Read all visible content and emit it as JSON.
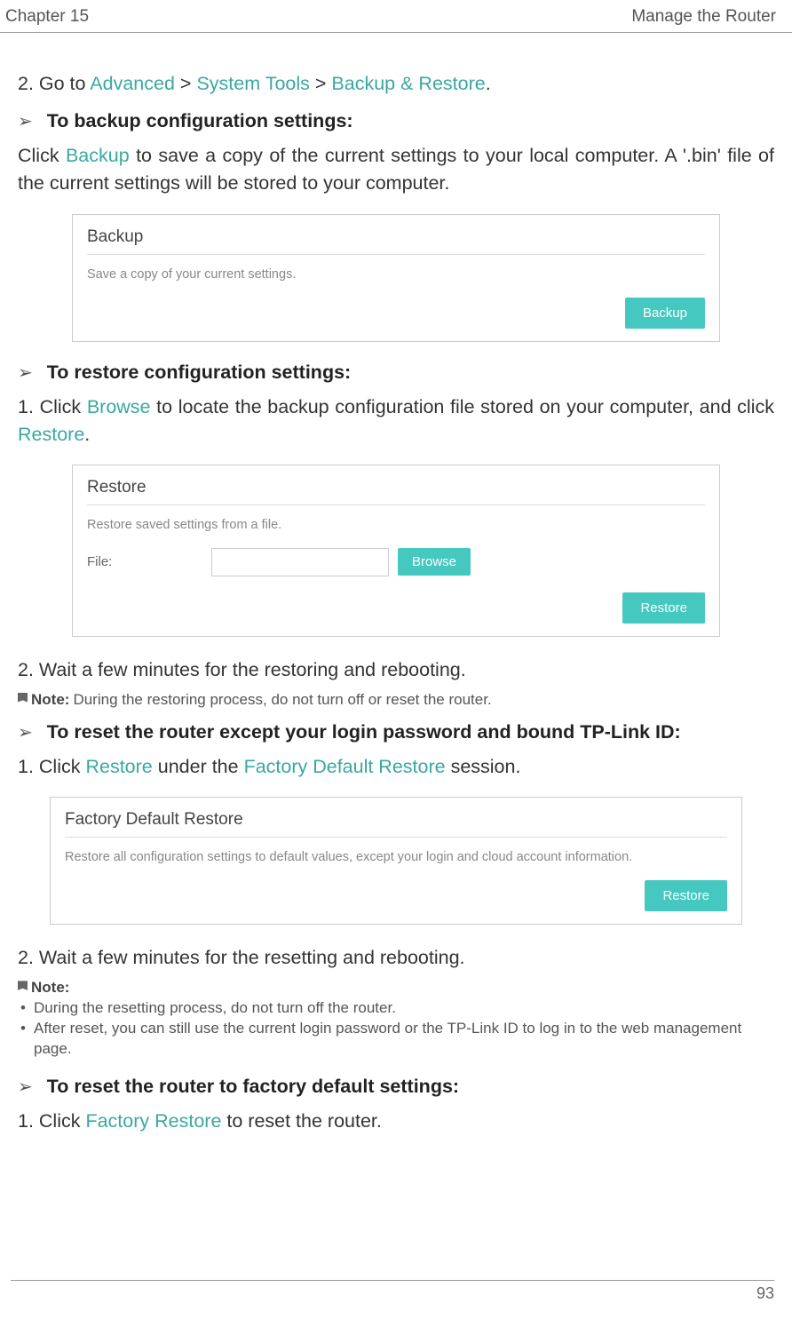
{
  "header": {
    "left": "Chapter 15",
    "right": "Manage the Router"
  },
  "step2_goto": {
    "prefix": "2. Go to ",
    "l1": "Advanced",
    "sep1": " > ",
    "l2": "System Tools",
    "sep2": " > ",
    "l3": "Backup & Restore",
    "suffix": "."
  },
  "sec_backup": {
    "heading": "To backup configuration settings:",
    "text_prefix": "Click ",
    "text_link": "Backup",
    "text_suffix": " to save a copy of the current settings to your local computer. A '.bin' file of the current settings will be stored to your computer."
  },
  "panel_backup": {
    "title": "Backup",
    "desc": "Save a copy of your current settings.",
    "btn": "Backup"
  },
  "sec_restore": {
    "heading": "To restore configuration settings:",
    "step1_prefix": "1. Click ",
    "step1_link1": "Browse",
    "step1_mid": " to locate the backup configuration file stored on your computer, and click ",
    "step1_link2": "Restore",
    "step1_suffix": "."
  },
  "panel_restore": {
    "title": "Restore",
    "desc": "Restore saved settings from a file.",
    "file_label": "File:",
    "browse_btn": "Browse",
    "restore_btn": "Restore"
  },
  "restore_step2": "2. Wait a few minutes for the restoring and rebooting.",
  "note1": {
    "label": "Note:",
    "text": " During the restoring process, do not turn off or reset the router."
  },
  "sec_reset_except": {
    "heading": "To reset the router except your login password and bound TP-Link ID:",
    "step1_prefix": "1. Click ",
    "step1_link1": "Restore",
    "step1_mid": " under the ",
    "step1_link2": "Factory Default Restore",
    "step1_suffix": " session."
  },
  "panel_factory": {
    "title": "Factory Default Restore",
    "desc": "Restore all configuration settings to default values, except your login and cloud account information.",
    "btn": "Restore"
  },
  "reset_step2": "2. Wait a few minutes for the resetting and rebooting.",
  "note2": {
    "label": "Note:",
    "b1": "During the resetting process, do not turn off the router.",
    "b2": "After reset, you can still use the current login password or the TP-Link ID to log in to the web management page."
  },
  "sec_factory_reset": {
    "heading": "To reset the router to factory default settings:",
    "step1_prefix": "1. Click ",
    "step1_link1": "Factory Restore",
    "step1_suffix": " to reset the router."
  },
  "page_number": "93"
}
